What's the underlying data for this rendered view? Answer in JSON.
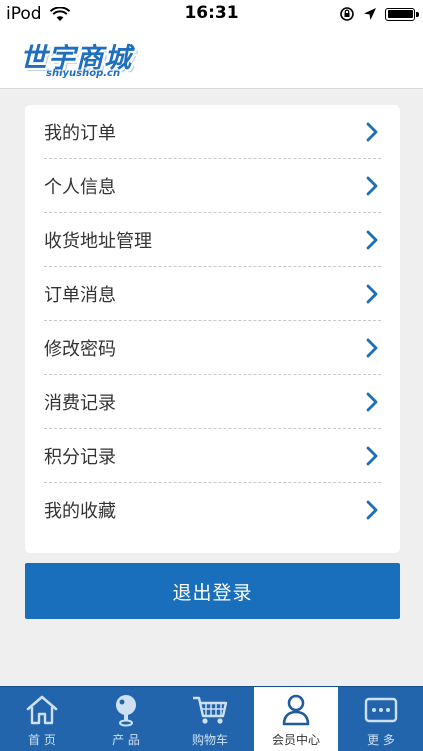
{
  "status_bar": {
    "carrier": "iPod",
    "time": "16:31"
  },
  "header": {
    "logo_text": "世宇商城",
    "logo_subtext": "shiyushop.cn"
  },
  "menu": [
    {
      "label": "我的订单"
    },
    {
      "label": "个人信息"
    },
    {
      "label": "收货地址管理"
    },
    {
      "label": "订单消息"
    },
    {
      "label": "修改密码"
    },
    {
      "label": "消费记录"
    },
    {
      "label": "积分记录"
    },
    {
      "label": "我的收藏"
    }
  ],
  "logout_label": "退出登录",
  "tabs": [
    {
      "label": "首 页",
      "icon": "home-icon"
    },
    {
      "label": "产 品",
      "icon": "product-icon"
    },
    {
      "label": "购物车",
      "icon": "cart-icon"
    },
    {
      "label": "会员中心",
      "icon": "user-icon",
      "active": true
    },
    {
      "label": "更 多",
      "icon": "more-icon"
    }
  ],
  "colors": {
    "accent": "#1a6fbc",
    "tabbar": "#2265ad",
    "chevron": "#1a6fbc",
    "background": "#efeff0"
  }
}
